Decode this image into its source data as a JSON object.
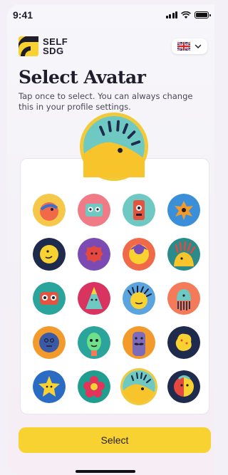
{
  "status": {
    "time": "9:41"
  },
  "brand": {
    "line1": "SELF",
    "line2": "SDG"
  },
  "language": {
    "selected": "UK flag"
  },
  "title": "Select Avatar",
  "subtitle": "Tap once to select. You can always change this in your profile settings.",
  "avatars": [
    "yellow-bird",
    "pink-box-eyes",
    "red-robot",
    "blue-orange-flower",
    "navy-moon-face",
    "purple-red-splat",
    "orange-purple-moon",
    "teal-spiky-head",
    "teal-owl-face",
    "red-yellow-cone",
    "blue-hedgehog",
    "orange-jellyfish",
    "orange-blue-face",
    "teal-alien",
    "purple-mustache",
    "navy-yellow-blob",
    "blue-star",
    "teal-red-flower",
    "yellow-sun-bird",
    "navy-split-face"
  ],
  "selected_avatar": "yellow-sun-bird",
  "select_button": "Select",
  "colors": {
    "accent": "#f8d231",
    "text": "#1f1d2b"
  }
}
